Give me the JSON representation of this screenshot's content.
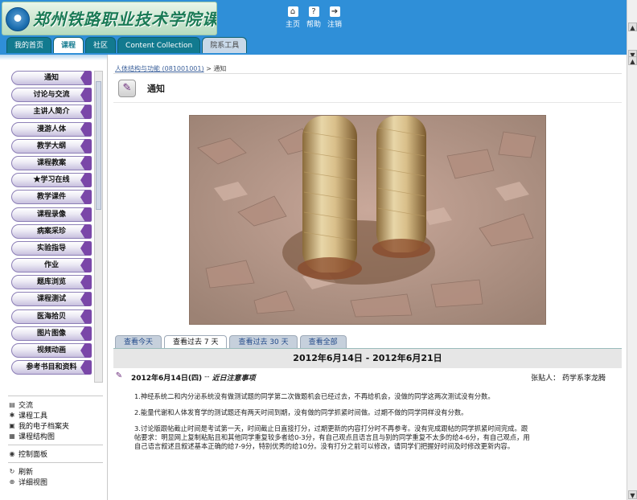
{
  "header": {
    "logo_text": "郑州铁路职业技术学院课程在线",
    "links": [
      {
        "icon": "home-icon",
        "label": "主页"
      },
      {
        "icon": "help-icon",
        "label": "帮助"
      },
      {
        "icon": "logout-icon",
        "label": "注销"
      }
    ],
    "tabs": [
      {
        "label": "我的首页",
        "active": false
      },
      {
        "label": "课程",
        "active": true
      },
      {
        "label": "社区",
        "active": false
      },
      {
        "label": "Content Collection",
        "active": false
      },
      {
        "label": "院系工具",
        "active": false
      }
    ]
  },
  "sidebar": {
    "menu": [
      "通知",
      "讨论与交流",
      "主讲人简介",
      "漫游人体",
      "教学大纲",
      "课程教案",
      "★学习在线",
      "教学课件",
      "课程录像",
      "病案采珍",
      "实验指导",
      "作业",
      "题库浏览",
      "课程测试",
      "医海拾贝",
      "图片图像",
      "视频动画",
      "参考书目和资料"
    ],
    "tools": [
      {
        "icon": "communication-icon",
        "label": "交流"
      },
      {
        "icon": "tools-icon",
        "label": "课程工具"
      },
      {
        "icon": "portfolio-icon",
        "label": "我的电子档案夹"
      },
      {
        "icon": "map-icon",
        "label": "课程结构图"
      }
    ],
    "control_panel": {
      "icon": "control-panel-icon",
      "label": "控制面板"
    },
    "bottom": [
      {
        "icon": "refresh-icon",
        "label": "刷新"
      },
      {
        "icon": "detail-view-icon",
        "label": "详细视图"
      }
    ]
  },
  "main": {
    "breadcrumb_course": "人体结构与功能 (081001001)",
    "breadcrumb_sep": " > ",
    "breadcrumb_page": "通知",
    "page_title": "通知",
    "page_icon": "announcement-icon",
    "view_tabs": [
      {
        "label": "查看今天",
        "active": false
      },
      {
        "label": "查看过去 7 天",
        "active": true
      },
      {
        "label": "查看过去 30 天",
        "active": false
      },
      {
        "label": "查看全部",
        "active": false
      }
    ],
    "date_range": "2012年6月14日 - 2012年6月21日",
    "announcement": {
      "date": "2012年6月14日(四)",
      "dash": "--",
      "subject": "近日注意事项",
      "poster_label": "张贴人：",
      "poster": "药学系李龙腾",
      "paragraphs": [
        "1.神经系统二和内分泌系统没有做测试题的同学第二次做题机会已经过去，不再给机会，没做的同学这两次测试没有分数。",
        "2.能量代谢和人体发育学的测试题还有两天时间到期，没有做的同学抓紧时间做。过期不做的同学同样没有分数。",
        "3.讨论版跟帖截止时间是考试第一天，时间截止日直接打分，过期更新的内容打分时不再参考。没有完成跟帖的同学抓紧时间完成。跟帖要求：明显网上复制粘贴且和其他同学重复较多者给0-3分，有自己观点且语言且与别的同学重复不太多的给4-6分，有自己观点，用自己语言叙述且叙述基本正确的给7-9分，特别优秀的给10分。没有打分之前可以修改，请同学们把握好时间及时修改更新内容。"
      ]
    }
  }
}
